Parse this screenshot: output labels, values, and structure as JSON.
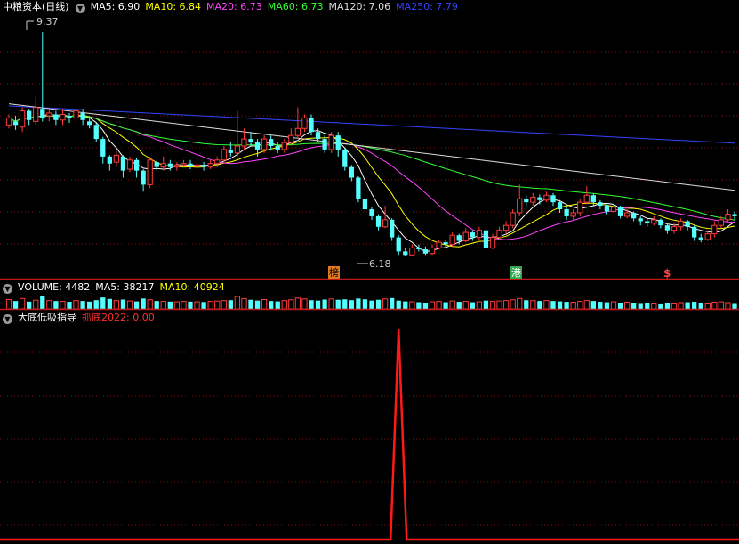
{
  "price_panel": {
    "title": "中粮资本(日线)",
    "ma_legend": [
      {
        "label": "MA5: 6.90",
        "color": "#ffffff"
      },
      {
        "label": "MA10: 6.84",
        "color": "#ffff00"
      },
      {
        "label": "MA20: 6.73",
        "color": "#ff44ff"
      },
      {
        "label": "MA60: 6.73",
        "color": "#33ff33"
      },
      {
        "label": "MA120: 7.06",
        "color": "#dddddd"
      },
      {
        "label": "MA250: 7.79",
        "color": "#3344ff"
      }
    ],
    "high_marker": "9.37",
    "low_marker": "6.18",
    "event_badges": [
      "榜",
      "港",
      "$"
    ]
  },
  "volume_panel": {
    "title": "VOLUME: 4482",
    "ma5": "MA5: 38217",
    "ma10": "MA10: 40924"
  },
  "indicator_panel": {
    "title": "大底低吸指导",
    "label": "抓底2022: 0.00"
  },
  "chart_data": {
    "type": "candlestick",
    "ylim": [
      5.9,
      9.6
    ],
    "up_color": "#ff3b3b",
    "down_color": "#54ffff",
    "candles": [
      [
        8.05,
        8.15,
        8.2,
        8.0
      ],
      [
        8.1,
        8.05,
        8.18,
        7.98
      ],
      [
        8.02,
        8.25,
        8.3,
        7.95
      ],
      [
        8.25,
        8.12,
        8.28,
        8.05
      ],
      [
        8.1,
        8.3,
        8.45,
        8.05
      ],
      [
        8.28,
        8.15,
        9.37,
        8.1
      ],
      [
        8.18,
        8.22,
        8.3,
        8.1
      ],
      [
        8.2,
        8.12,
        8.25,
        8.05
      ],
      [
        8.12,
        8.2,
        8.28,
        8.05
      ],
      [
        8.18,
        8.15,
        8.22,
        8.08
      ],
      [
        8.15,
        8.25,
        8.3,
        8.1
      ],
      [
        8.22,
        8.12,
        8.28,
        8.05
      ],
      [
        8.1,
        8.05,
        8.15,
        8.0
      ],
      [
        8.05,
        7.85,
        8.08,
        7.8
      ],
      [
        7.85,
        7.6,
        7.88,
        7.5
      ],
      [
        7.6,
        7.5,
        7.62,
        7.4
      ],
      [
        7.52,
        7.62,
        7.68,
        7.45
      ],
      [
        7.6,
        7.4,
        7.62,
        7.3
      ],
      [
        7.42,
        7.55,
        7.6,
        7.38
      ],
      [
        7.55,
        7.4,
        7.58,
        7.3
      ],
      [
        7.4,
        7.2,
        7.42,
        7.1
      ],
      [
        7.2,
        7.55,
        7.6,
        7.15
      ],
      [
        7.52,
        7.45,
        7.55,
        7.4
      ],
      [
        7.45,
        7.5,
        7.6,
        7.4
      ],
      [
        7.5,
        7.45,
        7.55,
        7.4
      ],
      [
        7.45,
        7.48,
        7.52,
        7.4
      ],
      [
        7.48,
        7.5,
        7.55,
        7.45
      ],
      [
        7.5,
        7.46,
        7.55,
        7.42
      ],
      [
        7.46,
        7.48,
        7.52,
        7.42
      ],
      [
        7.48,
        7.45,
        7.52,
        7.4
      ],
      [
        7.45,
        7.5,
        7.55,
        7.42
      ],
      [
        7.5,
        7.55,
        7.6,
        7.45
      ],
      [
        7.55,
        7.7,
        7.75,
        7.5
      ],
      [
        7.7,
        7.65,
        7.8,
        7.6
      ],
      [
        7.65,
        7.75,
        8.25,
        7.6
      ],
      [
        7.75,
        7.85,
        8.0,
        7.7
      ],
      [
        7.85,
        7.8,
        7.95,
        7.75
      ],
      [
        7.8,
        7.7,
        7.85,
        7.6
      ],
      [
        7.7,
        7.85,
        7.9,
        7.65
      ],
      [
        7.85,
        7.75,
        7.9,
        7.7
      ],
      [
        7.75,
        7.7,
        7.8,
        7.65
      ],
      [
        7.7,
        7.8,
        7.85,
        7.65
      ],
      [
        7.8,
        7.9,
        8.0,
        7.75
      ],
      [
        7.9,
        8.0,
        8.3,
        7.85
      ],
      [
        8.0,
        8.15,
        8.2,
        7.95
      ],
      [
        8.15,
        7.95,
        8.2,
        7.9
      ],
      [
        7.95,
        7.85,
        8.0,
        7.8
      ],
      [
        7.85,
        7.7,
        7.9,
        7.65
      ],
      [
        7.7,
        7.9,
        7.95,
        7.65
      ],
      [
        7.9,
        7.7,
        7.95,
        7.6
      ],
      [
        7.7,
        7.45,
        7.72,
        7.4
      ],
      [
        7.45,
        7.3,
        7.48,
        7.25
      ],
      [
        7.3,
        7.0,
        7.32,
        6.95
      ],
      [
        7.0,
        6.85,
        7.02,
        6.8
      ],
      [
        6.85,
        6.75,
        6.88,
        6.7
      ],
      [
        6.75,
        6.6,
        6.78,
        6.55
      ],
      [
        6.6,
        6.7,
        6.9,
        6.58
      ],
      [
        6.7,
        6.45,
        6.72,
        6.4
      ],
      [
        6.45,
        6.25,
        6.48,
        6.2
      ],
      [
        6.25,
        6.2,
        6.3,
        6.18
      ],
      [
        6.2,
        6.3,
        6.35,
        6.18
      ],
      [
        6.3,
        6.28,
        6.35,
        6.25
      ],
      [
        6.28,
        6.22,
        6.32,
        6.2
      ],
      [
        6.22,
        6.3,
        6.35,
        6.2
      ],
      [
        6.3,
        6.38,
        6.42,
        6.28
      ],
      [
        6.38,
        6.35,
        6.42,
        6.3
      ],
      [
        6.35,
        6.48,
        6.52,
        6.32
      ],
      [
        6.48,
        6.4,
        6.5,
        6.35
      ],
      [
        6.4,
        6.52,
        6.58,
        6.38
      ],
      [
        6.52,
        6.45,
        6.55,
        6.4
      ],
      [
        6.45,
        6.55,
        6.6,
        6.42
      ],
      [
        6.55,
        6.3,
        6.58,
        6.28
      ],
      [
        6.3,
        6.45,
        6.5,
        6.28
      ],
      [
        6.45,
        6.55,
        6.6,
        6.42
      ],
      [
        6.55,
        6.62,
        6.68,
        6.5
      ],
      [
        6.62,
        6.8,
        6.85,
        6.58
      ],
      [
        6.8,
        7.0,
        7.2,
        6.75
      ],
      [
        7.0,
        6.95,
        7.05,
        6.88
      ],
      [
        6.95,
        7.02,
        7.08,
        6.9
      ],
      [
        7.02,
        6.98,
        7.06,
        6.92
      ],
      [
        6.98,
        7.05,
        7.1,
        6.95
      ],
      [
        7.05,
        6.95,
        7.08,
        6.9
      ],
      [
        6.95,
        6.85,
        6.98,
        6.8
      ],
      [
        6.85,
        6.75,
        6.88,
        6.7
      ],
      [
        6.75,
        6.8,
        6.85,
        6.7
      ],
      [
        6.8,
        6.95,
        7.0,
        6.75
      ],
      [
        6.95,
        7.05,
        7.18,
        6.92
      ],
      [
        7.05,
        6.95,
        7.08,
        6.9
      ],
      [
        6.95,
        6.9,
        6.98,
        6.85
      ],
      [
        6.9,
        6.82,
        6.92,
        6.78
      ],
      [
        6.82,
        6.88,
        6.92,
        6.8
      ],
      [
        6.88,
        6.75,
        6.9,
        6.72
      ],
      [
        6.75,
        6.8,
        6.85,
        6.72
      ],
      [
        6.8,
        6.72,
        6.82,
        6.68
      ],
      [
        6.72,
        6.68,
        6.75,
        6.62
      ],
      [
        6.68,
        6.65,
        6.72,
        6.6
      ],
      [
        6.65,
        6.7,
        6.75,
        6.62
      ],
      [
        6.7,
        6.62,
        6.72,
        6.58
      ],
      [
        6.62,
        6.55,
        6.65,
        6.5
      ],
      [
        6.55,
        6.6,
        6.65,
        6.5
      ],
      [
        6.6,
        6.68,
        6.72,
        6.55
      ],
      [
        6.68,
        6.6,
        6.7,
        6.55
      ],
      [
        6.6,
        6.45,
        6.62,
        6.4
      ],
      [
        6.45,
        6.42,
        6.5,
        6.38
      ],
      [
        6.42,
        6.5,
        6.55,
        6.4
      ],
      [
        6.5,
        6.62,
        6.68,
        6.45
      ],
      [
        6.62,
        6.7,
        6.75,
        6.58
      ],
      [
        6.7,
        6.78,
        6.85,
        6.65
      ],
      [
        6.78,
        6.75,
        6.82,
        6.7
      ]
    ],
    "volume": [
      45,
      38,
      50,
      35,
      42,
      60,
      40,
      38,
      36,
      34,
      40,
      38,
      35,
      42,
      55,
      48,
      40,
      45,
      38,
      36,
      50,
      44,
      38,
      36,
      35,
      34,
      36,
      35,
      34,
      33,
      36,
      38,
      40,
      42,
      60,
      50,
      44,
      40,
      45,
      38,
      36,
      40,
      44,
      52,
      48,
      42,
      40,
      45,
      48,
      44,
      46,
      42,
      50,
      46,
      40,
      44,
      48,
      52,
      40,
      36,
      34,
      32,
      30,
      34,
      36,
      32,
      38,
      34,
      36,
      32,
      34,
      40,
      36,
      38,
      40,
      44,
      50,
      42,
      40,
      38,
      40,
      38,
      36,
      34,
      32,
      36,
      40,
      38,
      34,
      32,
      34,
      30,
      32,
      30,
      28,
      30,
      28,
      26,
      30,
      28,
      30,
      32,
      34,
      30,
      28,
      32,
      34,
      30,
      28
    ],
    "indicator": {
      "spike_index": 58,
      "spike_value": 100,
      "ylim": [
        0,
        100
      ]
    }
  }
}
